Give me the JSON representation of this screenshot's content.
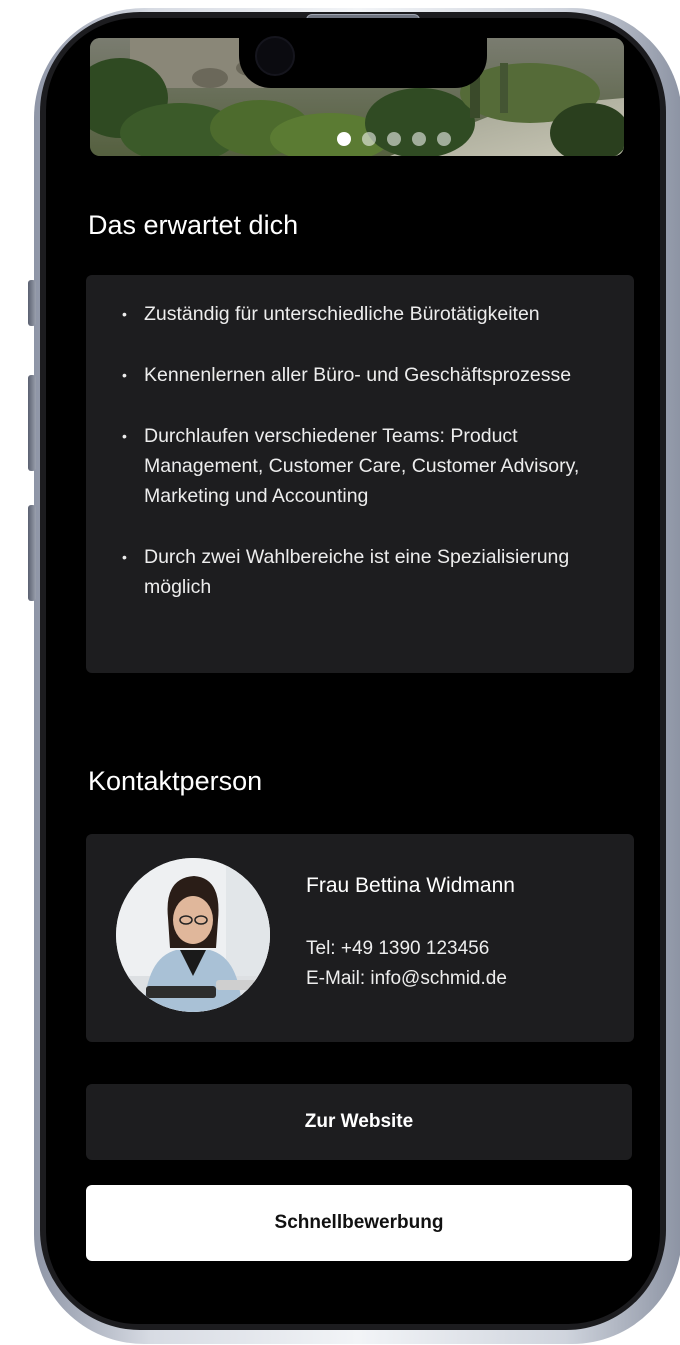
{
  "hero": {
    "slides_total": 5,
    "active_slide": 1
  },
  "tasks": {
    "title": "Das erwartet dich",
    "items": [
      "Zuständig für unterschiedliche Bürotätigkeiten",
      "Kennenlernen aller Büro- und Geschäftsprozesse",
      "Durchlaufen verschiedener Teams: Product Management, Customer Care, Customer Advisory, Marketing und Accounting",
      "Durch zwei Wahlbereiche ist eine Spezialisierung möglich"
    ]
  },
  "contact": {
    "title": "Kontaktperson",
    "name": "Frau Bettina Widmann",
    "phone": "Tel: +49 1390 123456",
    "email": "E-Mail: info@schmid.de"
  },
  "actions": {
    "website_label": "Zur Website",
    "apply_label": "Schnellbewerbung"
  },
  "colors": {
    "screen_background": "#000000",
    "card_background": "#1d1d1f",
    "primary_button": "#ffffff",
    "text": "#ffffff"
  }
}
